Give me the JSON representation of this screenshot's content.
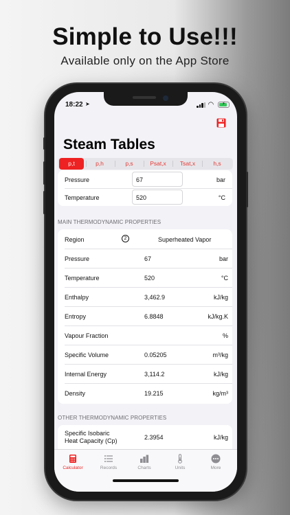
{
  "promo": {
    "headline": "Simple to Use!!!",
    "subheadline": "Available only on the App Store"
  },
  "status_bar": {
    "time": "18:22"
  },
  "app": {
    "title": "Steam Tables",
    "modes": [
      "p,t",
      "p,h",
      "p,s",
      "Psat,x",
      "Tsat,x",
      "h,s"
    ],
    "active_mode": "p,t",
    "inputs": [
      {
        "label": "Pressure",
        "value": "67",
        "unit": "bar"
      },
      {
        "label": "Temperature",
        "value": "520",
        "unit": "°C"
      }
    ],
    "main_section_title": "MAIN THERMODYNAMIC PROPERTIES",
    "region": {
      "label": "Region",
      "number": "2",
      "value": "Superheated Vapor"
    },
    "main_properties": [
      {
        "label": "Pressure",
        "value": "67",
        "unit": "bar"
      },
      {
        "label": "Temperature",
        "value": "520",
        "unit": "°C"
      },
      {
        "label": "Enthalpy",
        "value": "3,462.9",
        "unit": "kJ/kg"
      },
      {
        "label": "Entropy",
        "value": "6.8848",
        "unit": "kJ/kg.K"
      },
      {
        "label": "Vapour Fraction",
        "value": "",
        "unit": "%"
      },
      {
        "label": "Specific Volume",
        "value": "0.05205",
        "unit": "m³/kg"
      },
      {
        "label": "Internal Energy",
        "value": "3,114.2",
        "unit": "kJ/kg"
      },
      {
        "label": "Density",
        "value": "19.215",
        "unit": "kg/m³"
      }
    ],
    "other_section_title": "OTHER THERMODYNAMIC PROPERTIES",
    "other_properties": [
      {
        "label_line1": "Specific Isobaric",
        "label_line2": "Heat Capacity (Cp)",
        "value": "2.3954",
        "unit": "kJ/kg"
      }
    ]
  },
  "tab_bar": {
    "items": [
      {
        "label": "Calculator",
        "icon": "calculator-icon"
      },
      {
        "label": "Records",
        "icon": "list-icon"
      },
      {
        "label": "Charts",
        "icon": "bar-chart-icon"
      },
      {
        "label": "Units",
        "icon": "thermometer-icon"
      },
      {
        "label": "More",
        "icon": "more-icon"
      }
    ],
    "active": "Calculator"
  },
  "colors": {
    "accent": "#ee2222",
    "background": "#f2f2f7"
  }
}
